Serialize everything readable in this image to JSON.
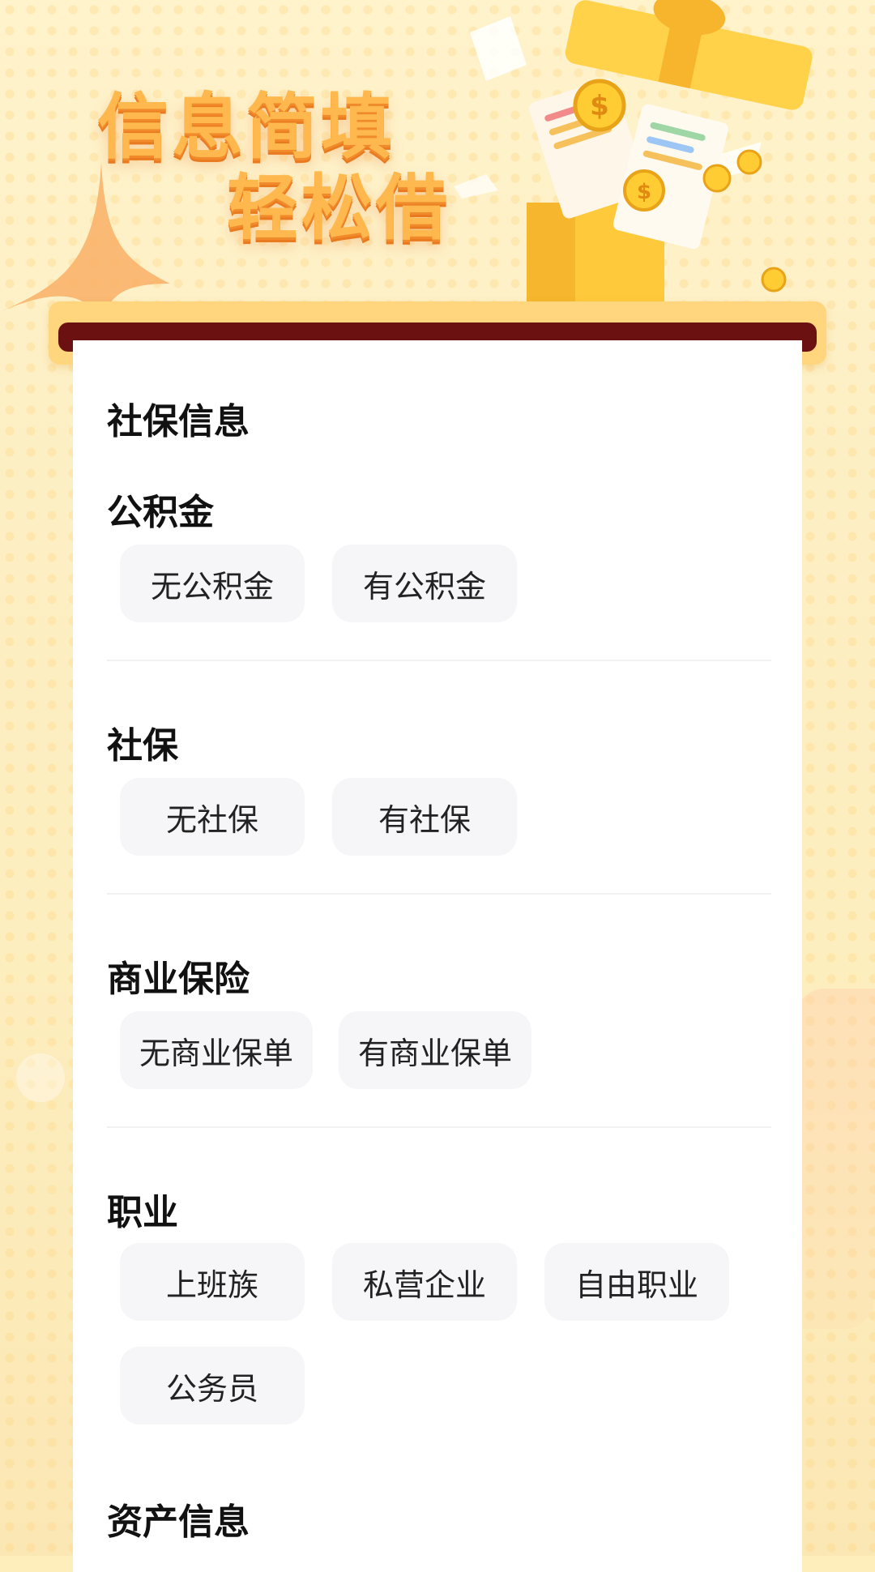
{
  "banner": {
    "headline_line1": "信息简填",
    "headline_line2": "轻松借",
    "illustration": "gift-box-with-coins-and-documents"
  },
  "form": {
    "section_social": "社保信息",
    "groups": [
      {
        "label": "公积金",
        "options": [
          "无公积金",
          "有公积金"
        ]
      },
      {
        "label": "社保",
        "options": [
          "无社保",
          "有社保"
        ]
      },
      {
        "label": "商业保险",
        "options": [
          "无商业保单",
          "有商业保单"
        ]
      },
      {
        "label": "职业",
        "options": [
          "上班族",
          "私营企业",
          "自由职业",
          "公务员"
        ]
      }
    ],
    "section_assets": "资产信息"
  },
  "colors": {
    "headline": "#ffb84d",
    "frame": "#ffd57e",
    "frame_slot": "#6b1111",
    "option_bg": "#f6f6f8",
    "page_bg": "#fdeebc"
  }
}
